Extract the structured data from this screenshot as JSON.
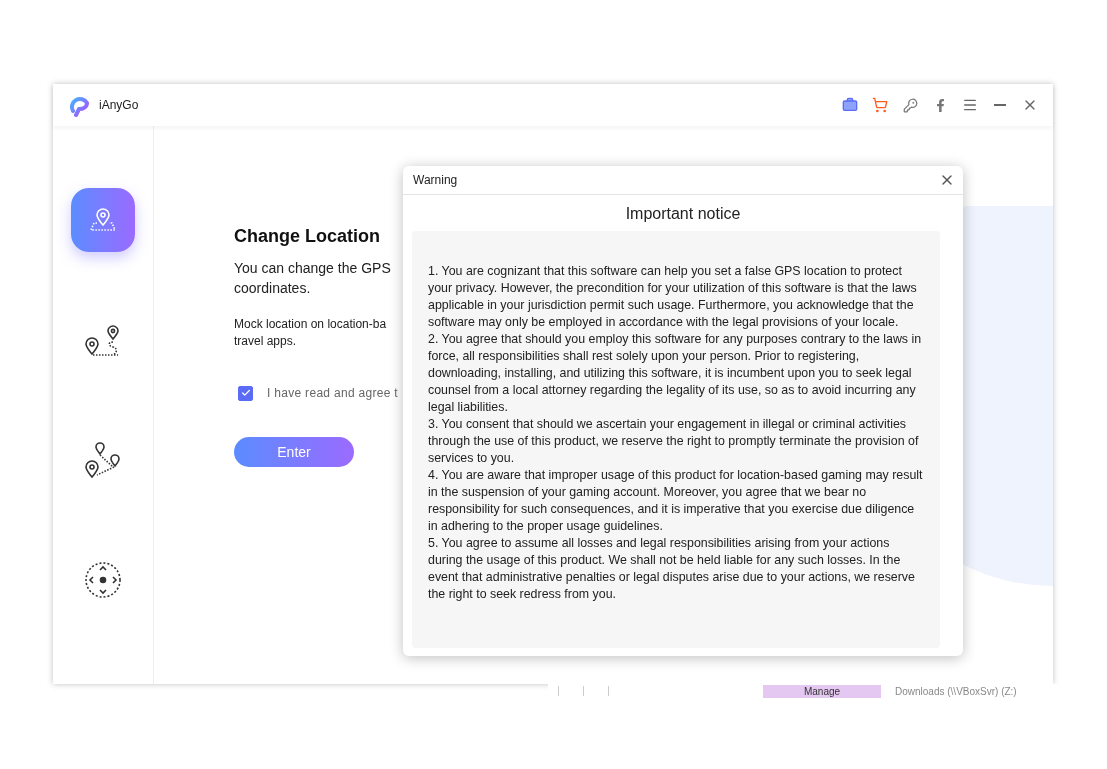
{
  "app": {
    "name": "iAnyGo"
  },
  "sidebar": {
    "items": [
      {
        "kind": "change-location",
        "selected": true
      },
      {
        "kind": "single-route",
        "selected": false
      },
      {
        "kind": "multi-route",
        "selected": false
      },
      {
        "kind": "joystick",
        "selected": false
      }
    ]
  },
  "main": {
    "title": "Change Location",
    "description_lines": [
      "You can change the GPS",
      "coordinates."
    ],
    "note_lines": [
      "Mock location on location-ba",
      "travel apps."
    ],
    "agree": {
      "checked": true,
      "label": "I have read and agree t"
    },
    "enter_button": "Enter"
  },
  "dialog": {
    "title": "Warning",
    "heading": "Important notice",
    "paragraphs": [
      "1. You are cognizant that this software can help you set a false GPS location to protect your privacy. However, the precondition for your utilization of this software is that the laws applicable in your jurisdiction permit such usage. Furthermore, you acknowledge that the software may only be employed in accordance with the legal provisions of your locale.",
      "2. You agree that should you employ this software for any purposes contrary to the laws in force, all responsibilities shall rest solely upon your person. Prior to registering, downloading, installing, and utilizing this software, it is incumbent upon you to seek legal counsel from a local attorney regarding the legality of its use, so as to avoid incurring any legal liabilities.",
      "3. You consent that should we ascertain your engagement in illegal or criminal activities through the use of this product, we reserve the right to promptly terminate the provision of services to you.",
      "4. You are aware that improper usage of this product for location-based gaming may result in the suspension of your gaming account. Moreover, you agree that we bear no responsibility for such consequences, and it is imperative that you exercise due diligence in adhering to the proper usage guidelines.",
      "5. You agree to assume all losses and legal responsibilities arising from your actions during the usage of this product. We shall not be held liable for any such losses. In the event that administrative penalties or legal disputes arise due to your actions, we reserve the right to seek redress from you."
    ]
  },
  "background_window": {
    "manage_tab": "Manage",
    "drive_label": "Downloads (\\\\VBoxSvr) (Z:)"
  }
}
